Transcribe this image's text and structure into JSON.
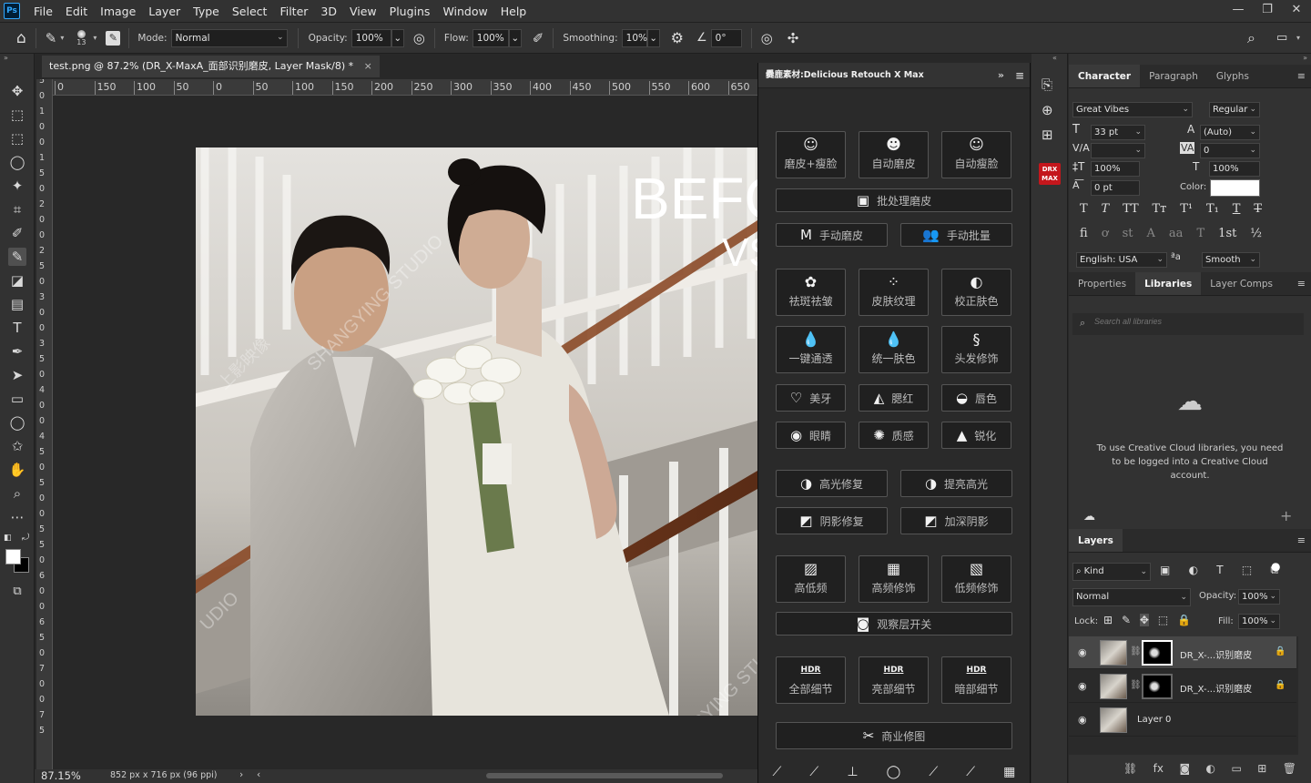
{
  "menu": {
    "logo": "Ps",
    "items": [
      "File",
      "Edit",
      "Image",
      "Layer",
      "Type",
      "Select",
      "Filter",
      "3D",
      "View",
      "Plugins",
      "Window",
      "Help"
    ]
  },
  "options": {
    "brush_size": "13",
    "mode_label": "Mode:",
    "mode_value": "Normal",
    "opacity_label": "Opacity:",
    "opacity_value": "100%",
    "flow_label": "Flow:",
    "flow_value": "100%",
    "smoothing_label": "Smoothing:",
    "smoothing_value": "10%",
    "angle_value": "0°"
  },
  "document": {
    "tab_title": "test.png @ 87.2% (DR_X-MaxA_面部识别磨皮, Layer Mask/8) *",
    "close": "×",
    "zoom": "87.15%",
    "info": "852 px x 716 px (96 ppi)"
  },
  "ruler": {
    "h_ticks": [
      "0",
      "150",
      "100",
      "50",
      "0",
      "50",
      "100",
      "150",
      "200",
      "250",
      "300",
      "350",
      "400",
      "450",
      "500",
      "550",
      "600",
      "650"
    ],
    "v_ticks": [
      "0",
      "5",
      "0",
      "1",
      "0",
      "0",
      "1",
      "5",
      "0",
      "2",
      "0",
      "0",
      "2",
      "5",
      "0",
      "3",
      "0",
      "0",
      "3",
      "5",
      "0",
      "4",
      "0",
      "0",
      "4",
      "5",
      "0",
      "5",
      "0",
      "0",
      "5",
      "5",
      "0",
      "6",
      "0",
      "0",
      "6",
      "5",
      "0",
      "7",
      "0",
      "0",
      "7",
      "5"
    ]
  },
  "photo": {
    "text1": "BEFO",
    "text2": "VS",
    "wm1": "SHANGYING STUDIO",
    "wm2": "上影映像",
    "wm3": "UDIO",
    "wm4": "SHANGYING STUDIO"
  },
  "plugin": {
    "title": "爨鹿素材:Delicious Retouch X Max",
    "row1": [
      {
        "icon": "☺",
        "label": "磨皮+瘦脸"
      },
      {
        "icon": "☻",
        "label": "自动磨皮"
      },
      {
        "icon": "☺",
        "label": "自动瘦脸"
      }
    ],
    "batch": {
      "icon": "▣",
      "label": "批处理磨皮"
    },
    "manual": [
      {
        "icon": "M",
        "label": "手动磨皮"
      },
      {
        "icon": "👥",
        "label": "手动批量"
      }
    ],
    "grid1": [
      {
        "icon": "✿",
        "label": "祛斑祛皱"
      },
      {
        "icon": "⁘",
        "label": "皮肤纹理"
      },
      {
        "icon": "◐",
        "label": "校正肤色"
      },
      {
        "icon": "💧",
        "label": "一键通透"
      },
      {
        "icon": "💧",
        "label": "统一肤色"
      },
      {
        "icon": "§",
        "label": "头发修饰"
      }
    ],
    "grid2": [
      {
        "icon": "♡",
        "label": "美牙"
      },
      {
        "icon": "◭",
        "label": "腮红"
      },
      {
        "icon": "◒",
        "label": "唇色"
      },
      {
        "icon": "◉",
        "label": "眼睛"
      },
      {
        "icon": "✺",
        "label": "质感"
      },
      {
        "icon": "▲",
        "label": "锐化"
      }
    ],
    "light": [
      {
        "icon": "◑",
        "label": "高光修复"
      },
      {
        "icon": "◑",
        "label": "提亮高光"
      },
      {
        "icon": "◩",
        "label": "阴影修复"
      },
      {
        "icon": "◩",
        "label": "加深阴影"
      }
    ],
    "freq": [
      {
        "icon": "▨",
        "label": "高低频"
      },
      {
        "icon": "▦",
        "label": "高频修饰"
      },
      {
        "icon": "▧",
        "label": "低频修饰"
      }
    ],
    "observe": {
      "icon": "◙",
      "label": "观察层开关"
    },
    "detail": [
      {
        "icon": "HDR",
        "label": "全部细节"
      },
      {
        "icon": "HDR",
        "label": "亮部细节"
      },
      {
        "icon": "HDR",
        "label": "暗部细节"
      }
    ],
    "commercial": {
      "icon": "✂",
      "label": "商业修图"
    }
  },
  "character": {
    "tabs": [
      "Character",
      "Paragraph",
      "Glyphs"
    ],
    "font": "Great Vibes",
    "style": "Regular",
    "size": "33 pt",
    "leading": "(Auto)",
    "tracking": "0",
    "vscale": "100%",
    "hscale": "100%",
    "baseline": "0 pt",
    "color_label": "Color:",
    "language": "English: USA",
    "aa_label": "ªa",
    "aa": "Smooth",
    "color": "#ffffff"
  },
  "libraries": {
    "tabs": [
      "Properties",
      "Libraries",
      "Layer Comps"
    ],
    "search_placeholder": "Search all libraries",
    "message": "To use Creative Cloud libraries, you need to be logged into a Creative Cloud account."
  },
  "layers": {
    "tab": "Layers",
    "kind": "Kind",
    "blend": "Normal",
    "opacity_label": "Opacity:",
    "opacity": "100%",
    "lock_label": "Lock:",
    "fill_label": "Fill:",
    "fill": "100%",
    "items": [
      {
        "name": "DR_X-...识别磨皮",
        "mask": true,
        "selected": true
      },
      {
        "name": "DR_X-...识别磨皮",
        "mask": true,
        "selected": false
      },
      {
        "name": "Layer 0",
        "mask": false,
        "selected": false
      }
    ]
  }
}
